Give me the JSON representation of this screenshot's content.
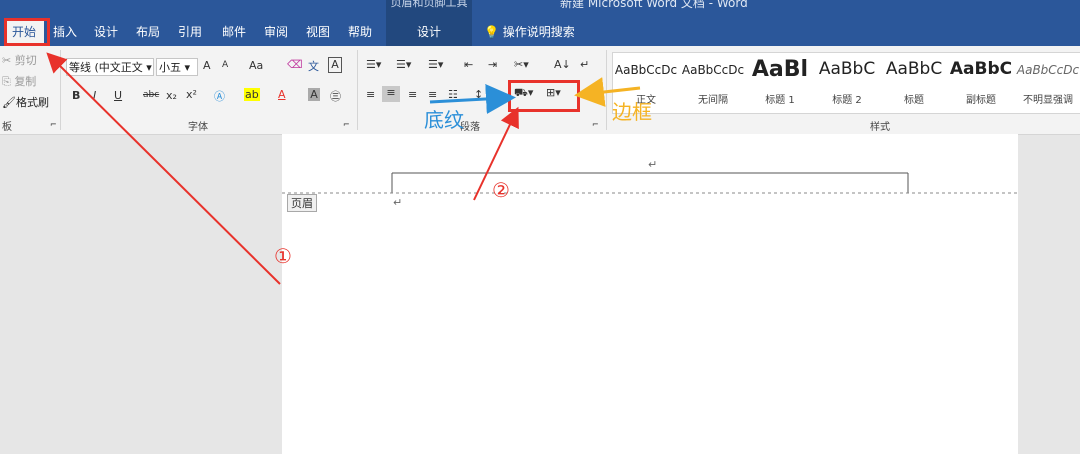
{
  "window": {
    "title": "新建 Microsoft Word 文档 - Word",
    "context_group": "页眉和页脚工具",
    "tell_me": "操作说明搜索"
  },
  "tabs": [
    "开始",
    "插入",
    "设计",
    "布局",
    "引用",
    "邮件",
    "审阅",
    "视图",
    "帮助",
    "设计"
  ],
  "clipboard": {
    "cut": "剪切",
    "copy": "复制",
    "format_painter": "格式刷",
    "label": "板"
  },
  "font": {
    "name": "等线 (中文正文",
    "size": "小五",
    "label": "字体",
    "grow": "A",
    "shrink": "A",
    "change_case": "Aa",
    "bold": "B",
    "italic": "I",
    "underline": "U",
    "strike": "abc",
    "subscript": "x₂",
    "superscript": "x²",
    "font_color": "A"
  },
  "paragraph": {
    "label": "段落"
  },
  "styles": {
    "label": "样式",
    "items": [
      {
        "sample": "AaBbCcDc",
        "name": "正文"
      },
      {
        "sample": "AaBbCcDc",
        "name": "无间隔"
      },
      {
        "sample": "AaBl",
        "name": "标题 1"
      },
      {
        "sample": "AaBbC",
        "name": "标题 2"
      },
      {
        "sample": "AaBbC",
        "name": "标题"
      },
      {
        "sample": "AaBbC",
        "name": "副标题"
      },
      {
        "sample": "AaBbCcDc",
        "name": "不明显强调"
      }
    ]
  },
  "document": {
    "header_tag": "页眉",
    "para_mark": "↵"
  },
  "annotations": {
    "shading_label": "底纹",
    "border_label": "边框",
    "step1": "①",
    "step2": "②"
  },
  "colors": {
    "accent": "#2b579a",
    "annotation_red": "#e8322b",
    "annotation_blue": "#2b8fd8",
    "annotation_orange": "#f5b324"
  }
}
